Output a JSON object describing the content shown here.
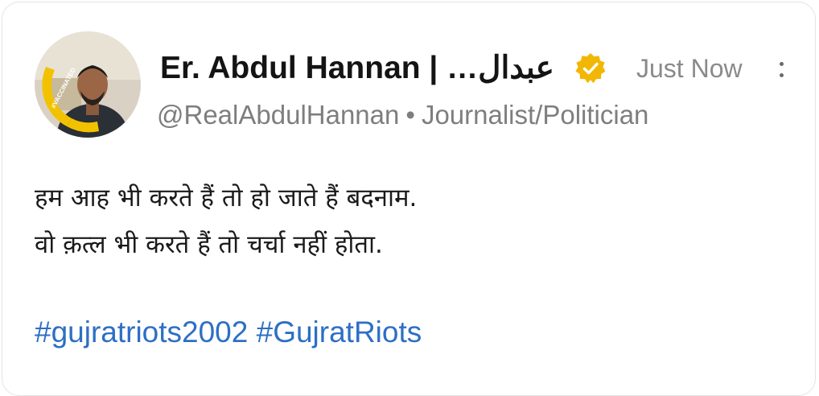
{
  "post": {
    "author": {
      "display_name": "Er. Abdul Hannan | …عبدال",
      "handle": "@RealAbdulHannan",
      "separator": "•",
      "role": "Journalist/Politician",
      "avatar_badge": "#VACCINATED",
      "verified_icon": "verified-check-icon"
    },
    "timestamp": "Just Now",
    "more_icon": "more-vertical-icon",
    "body_lines": [
      "हम आह भी करते हैं तो हो जाते हैं बदनाम.",
      "वो क़त्ल भी करते हैं तो चर्चा नहीं होता."
    ],
    "hashtags": [
      "#gujratriots2002",
      "#GujratRiots"
    ]
  },
  "colors": {
    "verified_badge": "#F2B705",
    "hashtag": "#2D6FC4",
    "avatar_ring": "#F2C200",
    "muted_text": "#7E7E7E"
  }
}
